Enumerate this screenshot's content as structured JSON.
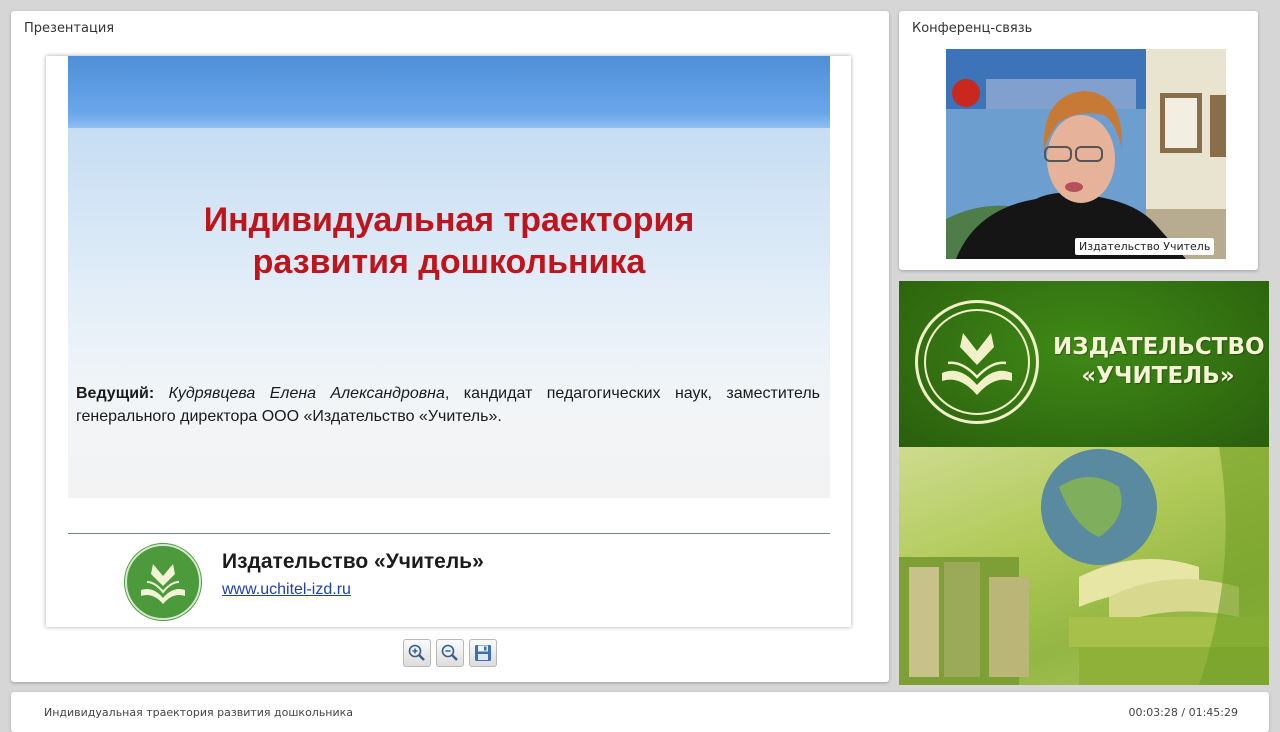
{
  "presentation_panel": {
    "title": "Презентация",
    "slide": {
      "title_line1": "Индивидуальная траектория",
      "title_line2": "развития дошкольника",
      "presenter_label": "Ведущий:",
      "presenter_name": "Кудрявцева Елена Александровна",
      "presenter_details": ", кандидат педагогических наук, заместитель генерального директора ООО «Издательство «Учитель».",
      "footer_name": "Издательство «Учитель»",
      "footer_url": "www.uchitel-izd.ru"
    },
    "toolbar": {
      "zoom_in_icon": "zoom-in-icon",
      "zoom_out_icon": "zoom-out-icon",
      "save_icon": "floppy-disk-icon"
    }
  },
  "conference_panel": {
    "title": "Конференц-связь",
    "video_caption": "Издательство Учитель"
  },
  "banner": {
    "line1": "ИЗДАТЕЛЬСТВО",
    "line2": "«УЧИТЕЛЬ»"
  },
  "status_bar": {
    "presentation_title": "Индивидуальная траектория развития дошкольника",
    "time": "00:03:28 / 01:45:29"
  },
  "colors": {
    "slide_title": "#c0141c",
    "brand_green": "#4c9a3c",
    "link": "#1d3fb0"
  }
}
